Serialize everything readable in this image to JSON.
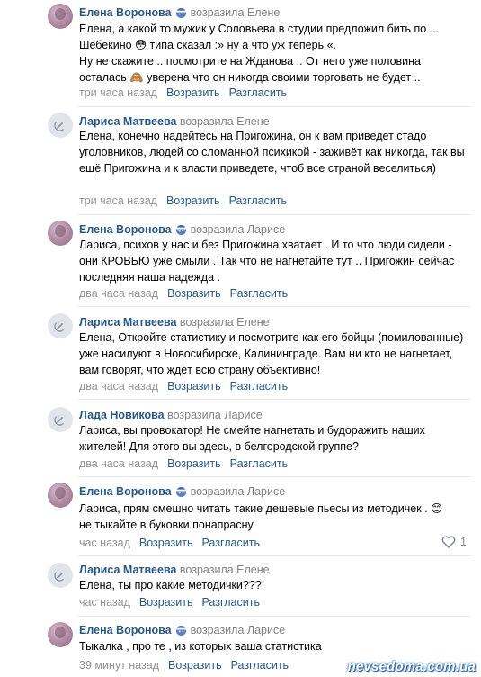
{
  "colors": {
    "link": "#2a5885",
    "meta": "#939393",
    "divider": "#e7e8ec"
  },
  "comments": [
    {
      "author": "Елена Воронова",
      "action": "возразила",
      "target": "Елене",
      "text": "Елена, а какой то мужик у Соловьева в студии предложил бить по ... Шебекино 😳 типа сказал :» ну а что уж теперь «.\nНу не скажите .. посмотрите на Жданова .. От него уже половина осталась 🙈 уверена что он никогда своими торговать не будет ..",
      "time": "три часа назад",
      "reply_label": "Возразить",
      "disagree_label": "Разгласить"
    },
    {
      "author": "Лариса Матвеева",
      "action": "возразила",
      "target": "Елене",
      "text": "Елена, конечно надейтесь на Пригожина, он к вам приведет стадо уголовников, людей со сломанной психикой - заживёт как никогда, так вы ещё Пригожина и к власти приведете, чтоб все страной веселиться)",
      "time": "три часа назад",
      "reply_label": "Возразить",
      "disagree_label": "Разгласить"
    },
    {
      "author": "Елена Воронова",
      "action": "возразила",
      "target": "Ларисе",
      "text": "Лариса, психов у нас и без Пригожина хватает . И то что люди сидели - они КРОВЬЮ уже смыли . Так что не нагнетайте тут .. Пригожин сейчас последняя наша надежда .",
      "time": "два часа назад",
      "reply_label": "Возразить",
      "disagree_label": "Разгласить"
    },
    {
      "author": "Лариса Матвеева",
      "action": "возразила",
      "target": "Елене",
      "text": "Елена, Откройте статистику и посмотрите как его бойцы (помилованные) уже насилуют в Новосибирске, Калининграде. Вам ни кто не нагнетает, вам говорят, что ждёт всю страну объективно!",
      "time": "два часа назад",
      "reply_label": "Возразить",
      "disagree_label": "Разгласить"
    },
    {
      "author": "Лада Новикова",
      "action": "возразила",
      "target": "Ларисе",
      "text": "Лариса, вы провокатор! Не смейте нагнетать и будоражить наших жителей! Для этого вы здесь, в белгородской группе?",
      "time": "два часа назад",
      "reply_label": "Возразить",
      "disagree_label": "Разгласить"
    },
    {
      "author": "Елена Воронова",
      "action": "возразила",
      "target": "Ларисе",
      "text": "Лариса, прям смешно читать такие дешевые пьесы из методичек . 😊\nне тыкайте в буковки понапрасну",
      "time": "час назад",
      "reply_label": "Возразить",
      "disagree_label": "Разгласить",
      "likes": "1"
    },
    {
      "author": "Лариса Матвеева",
      "action": "возразила",
      "target": "Елене",
      "text": "Елена, ты про какие методички???",
      "time": "час назад",
      "reply_label": "Возразить",
      "disagree_label": "Разгласить"
    },
    {
      "author": "Елена Воронова",
      "action": "возразила",
      "target": "Ларисе",
      "text": "Тыкалка , про те , из которых ваша статистика",
      "time": "39 минут назад",
      "reply_label": "Возразить",
      "disagree_label": "Разгласить"
    }
  ],
  "watermark": "nevsedoma.com.ua"
}
